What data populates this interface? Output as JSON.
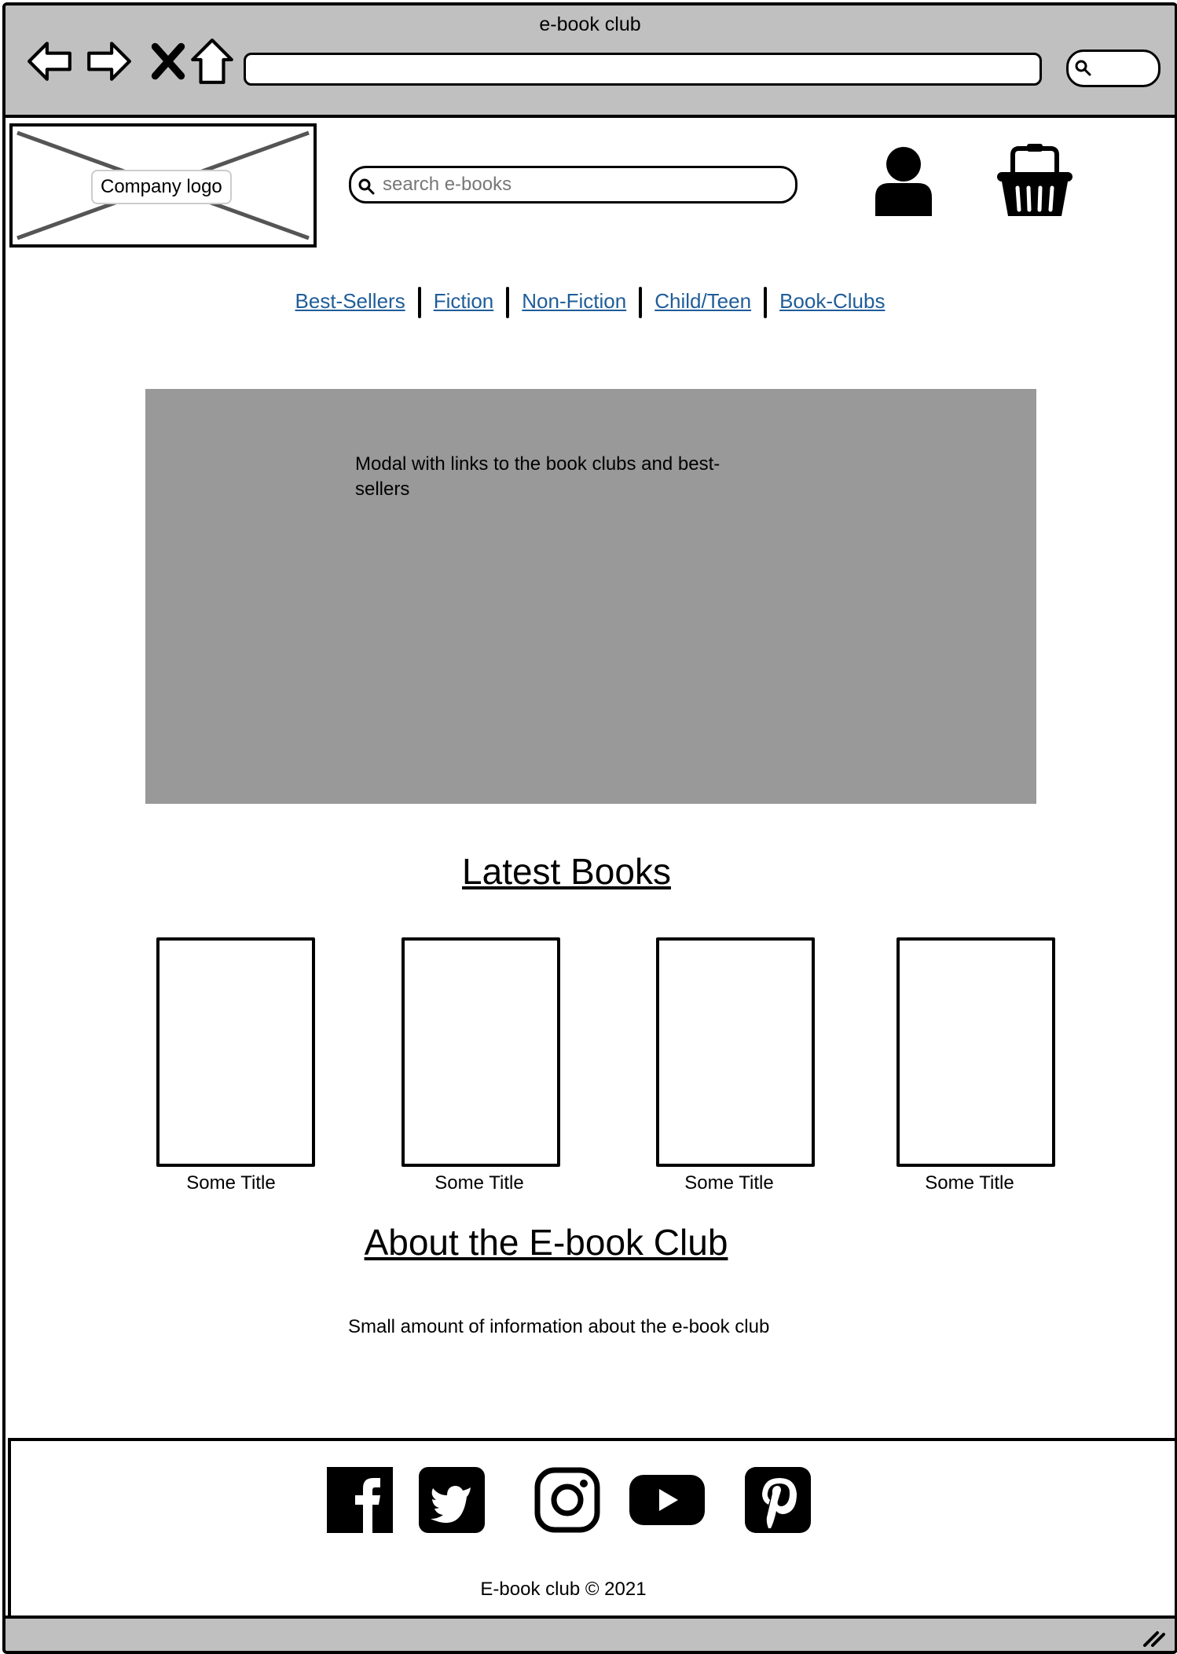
{
  "window": {
    "title": "e-book club"
  },
  "header": {
    "logo_label": "Company logo",
    "search_placeholder": "search e-books"
  },
  "nav": {
    "items": [
      {
        "label": "Best-Sellers"
      },
      {
        "label": "Fiction"
      },
      {
        "label": "Non-Fiction"
      },
      {
        "label": "Child/Teen"
      },
      {
        "label": "Book-Clubs"
      }
    ]
  },
  "modal": {
    "text": "Modal with links to the book clubs and best-sellers"
  },
  "latest": {
    "heading": "Latest Books",
    "books": [
      {
        "title": "Some Title"
      },
      {
        "title": "Some Title"
      },
      {
        "title": "Some Title"
      },
      {
        "title": "Some Title"
      }
    ]
  },
  "about": {
    "heading": "About the E-book Club",
    "text": "Small amount of information about the e-book club"
  },
  "footer": {
    "social_icons": [
      "facebook-icon",
      "twitter-icon",
      "instagram-icon",
      "youtube-icon",
      "pinterest-icon"
    ],
    "copyright": "E-book club © 2021"
  },
  "colors": {
    "chrome": "#c0c0c0",
    "modal": "#999999",
    "link": "#1f5d99"
  }
}
